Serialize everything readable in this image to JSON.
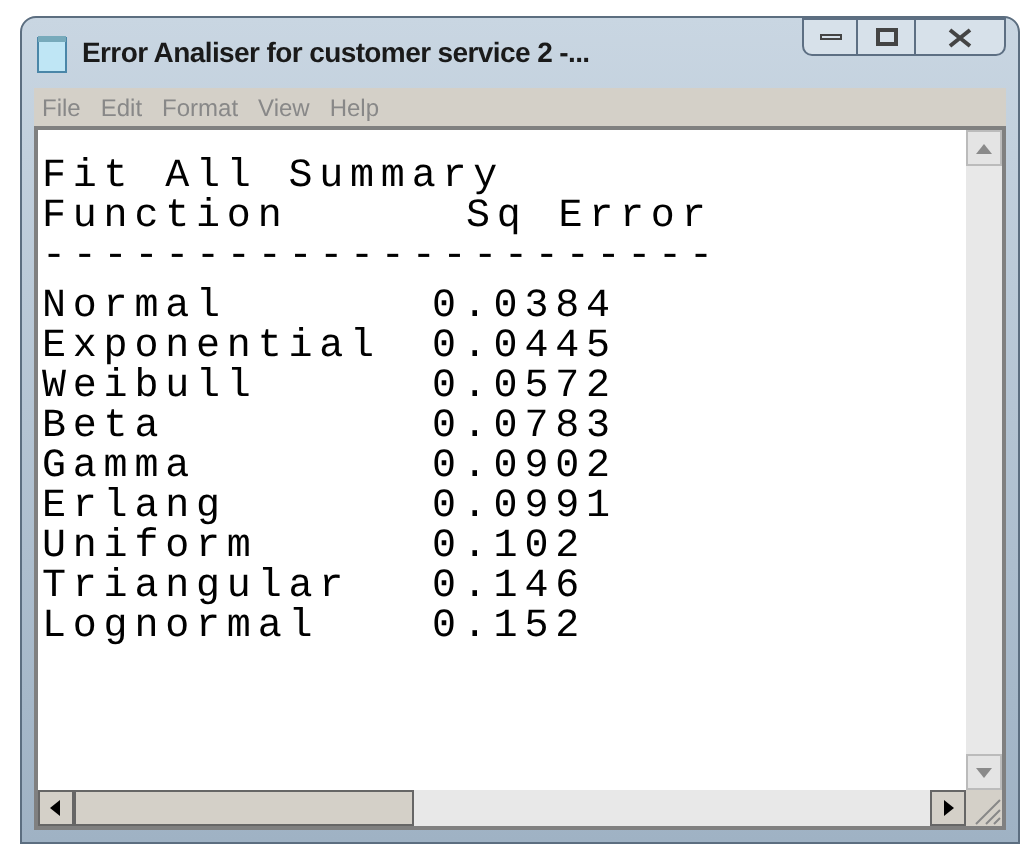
{
  "window": {
    "title": "Error Analiser for customer service 2 -..."
  },
  "menu": [
    "File",
    "Edit",
    "Format",
    "View",
    "Help"
  ],
  "document": {
    "title": "Fit All Summary",
    "columns": [
      "Function",
      "Sq Error"
    ],
    "separator": "----------------------",
    "rows": [
      {
        "function": "Normal",
        "error": "0.0384"
      },
      {
        "function": "Exponential",
        "error": "0.0445"
      },
      {
        "function": "Weibull",
        "error": "0.0572"
      },
      {
        "function": "Beta",
        "error": "0.0783"
      },
      {
        "function": "Gamma",
        "error": "0.0902"
      },
      {
        "function": "Erlang",
        "error": "0.0991"
      },
      {
        "function": "Uniform",
        "error": "0.102"
      },
      {
        "function": "Triangular",
        "error": "0.146"
      },
      {
        "function": "Lognormal",
        "error": "0.152"
      }
    ]
  }
}
